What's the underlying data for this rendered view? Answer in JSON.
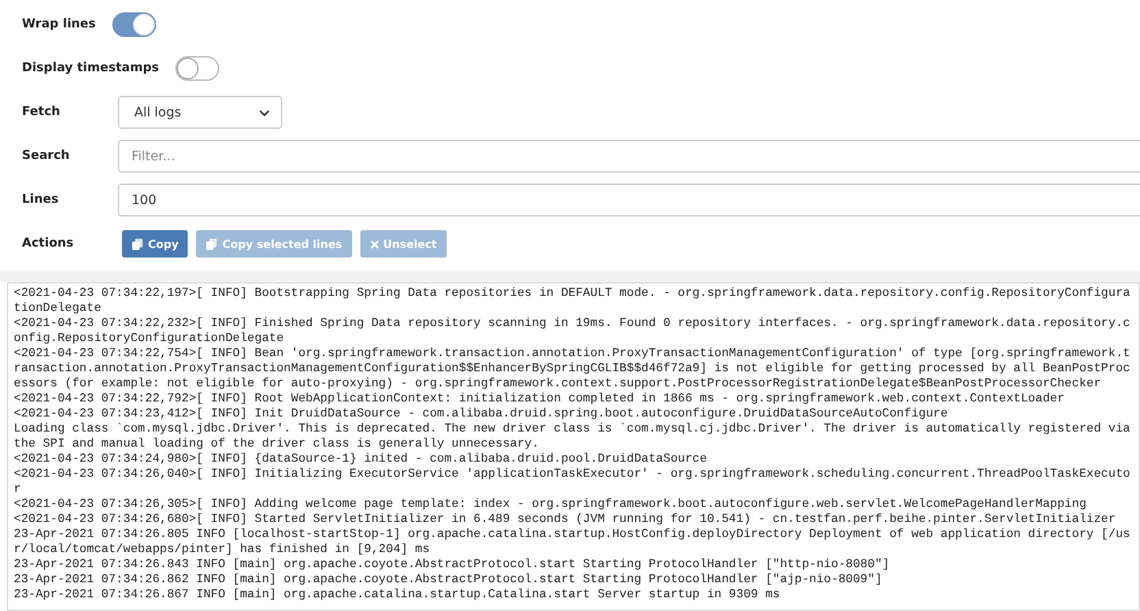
{
  "settings": [
    {
      "kind": "toggle",
      "label": "Wrap lines",
      "on": true
    },
    {
      "kind": "toggle",
      "label": "Display timestamps",
      "on": false
    },
    {
      "kind": "select",
      "label": "Fetch",
      "value": "All logs"
    },
    {
      "kind": "input",
      "label": "Search",
      "placeholder": "Filter..."
    },
    {
      "kind": "input",
      "label": "Lines",
      "value": "100"
    },
    {
      "kind": "actions",
      "label": "Actions",
      "buttons": [
        {
          "label": "Copy",
          "disabled": false
        },
        {
          "label": "Copy selected lines",
          "disabled": true
        },
        {
          "label": "Unselect",
          "disabled": true
        }
      ]
    }
  ],
  "log_lines": [
    "<2021-04-23 07:34:22,197>[ INFO] Bootstrapping Spring Data repositories in DEFAULT mode. - org.springframework.data.repository.config.RepositoryConfigurationDelegate",
    "<2021-04-23 07:34:22,232>[ INFO] Finished Spring Data repository scanning in 19ms. Found 0 repository interfaces. - org.springframework.data.repository.config.RepositoryConfigurationDelegate",
    "<2021-04-23 07:34:22,754>[ INFO] Bean 'org.springframework.transaction.annotation.ProxyTransactionManagementConfiguration' of type [org.springframework.transaction.annotation.ProxyTransactionManagementConfiguration$$EnhancerBySpringCGLIB$$d46f72a9] is not eligible for getting processed by all BeanPostProcessors (for example: not eligible for auto-proxying) - org.springframework.context.support.PostProcessorRegistrationDelegate$BeanPostProcessorChecker",
    "<2021-04-23 07:34:22,792>[ INFO] Root WebApplicationContext: initialization completed in 1866 ms - org.springframework.web.context.ContextLoader",
    "<2021-04-23 07:34:23,412>[ INFO] Init DruidDataSource - com.alibaba.druid.spring.boot.autoconfigure.DruidDataSourceAutoConfigure",
    "Loading class `com.mysql.jdbc.Driver'. This is deprecated. The new driver class is `com.mysql.cj.jdbc.Driver'. The driver is automatically registered via the SPI and manual loading of the driver class is generally unnecessary.",
    "<2021-04-23 07:34:24,980>[ INFO] {dataSource-1} inited - com.alibaba.druid.pool.DruidDataSource",
    "<2021-04-23 07:34:26,040>[ INFO] Initializing ExecutorService 'applicationTaskExecutor' - org.springframework.scheduling.concurrent.ThreadPoolTaskExecutor",
    "<2021-04-23 07:34:26,305>[ INFO] Adding welcome page template: index - org.springframework.boot.autoconfigure.web.servlet.WelcomePageHandlerMapping",
    "<2021-04-23 07:34:26,680>[ INFO] Started ServletInitializer in 6.489 seconds (JVM running for 10.541) - cn.testfan.perf.beihe.pinter.ServletInitializer",
    "23-Apr-2021 07:34:26.805 INFO [localhost-startStop-1] org.apache.catalina.startup.HostConfig.deployDirectory Deployment of web application directory [/usr/local/tomcat/webapps/pinter] has finished in [9,204] ms",
    "23-Apr-2021 07:34:26.843 INFO [main] org.apache.coyote.AbstractProtocol.start Starting ProtocolHandler [\"http-nio-8080\"]",
    "23-Apr-2021 07:34:26.862 INFO [main] org.apache.coyote.AbstractProtocol.start Starting ProtocolHandler [\"ajp-nio-8009\"]",
    "23-Apr-2021 07:34:26.867 INFO [main] org.apache.catalina.startup.Catalina.start Server startup in 9309 ms"
  ]
}
